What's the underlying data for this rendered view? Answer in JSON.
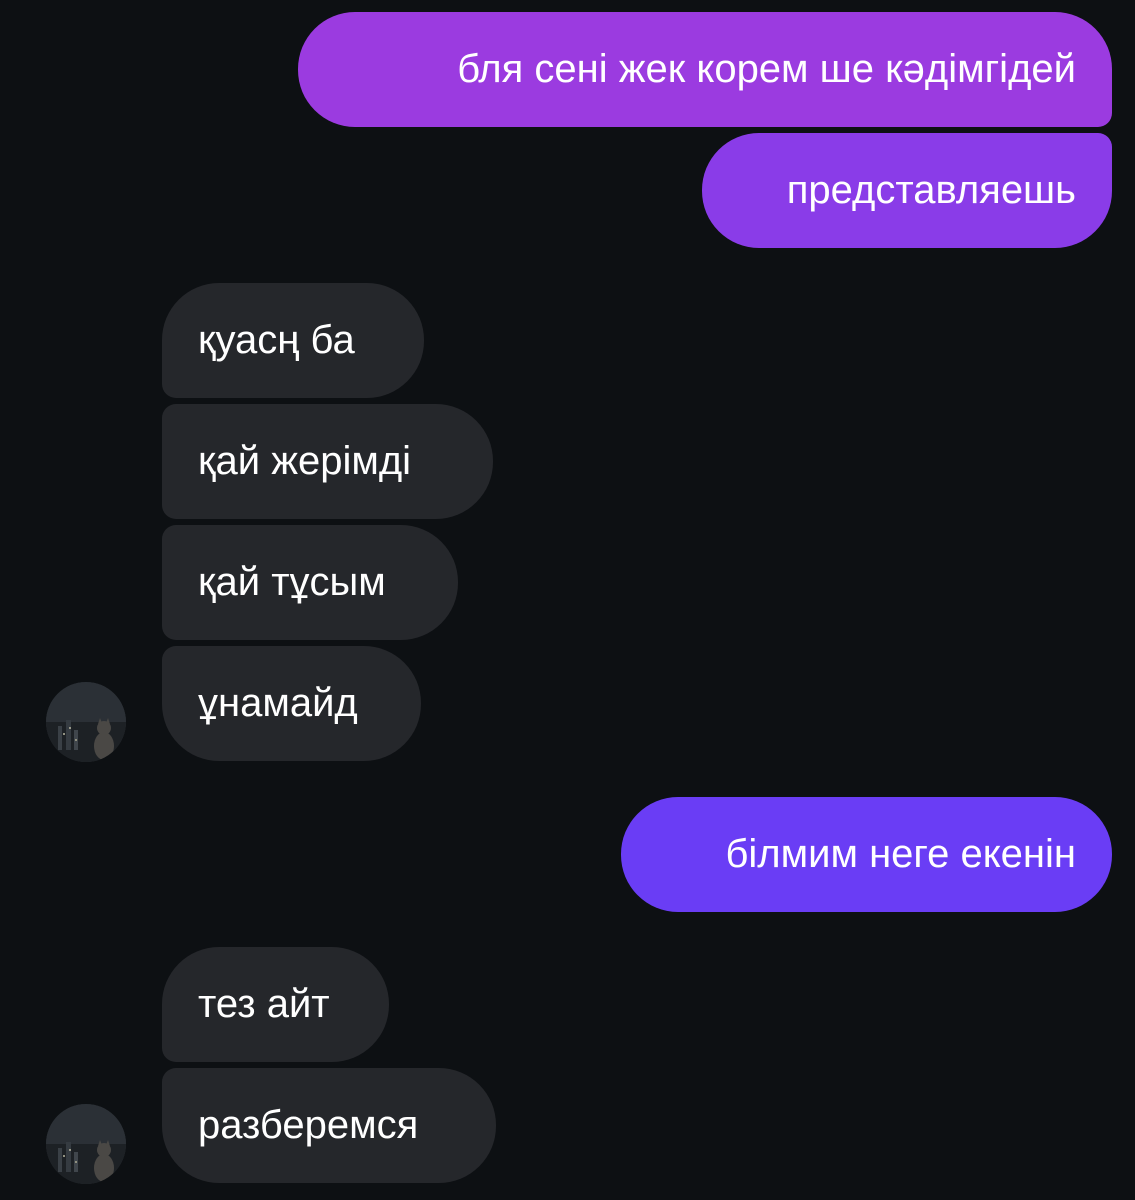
{
  "messages": [
    {
      "sender": "me",
      "text": "бля сені жек корем ше кәдімгідей"
    },
    {
      "sender": "me",
      "text": "представляешь"
    },
    {
      "sender": "them",
      "text": "қуасң ба"
    },
    {
      "sender": "them",
      "text": "қай жерімді"
    },
    {
      "sender": "them",
      "text": "қай тұсым"
    },
    {
      "sender": "them",
      "text": "ұнамайд"
    },
    {
      "sender": "me",
      "text": "білмим неге екенін"
    },
    {
      "sender": "them",
      "text": "тез айт"
    },
    {
      "sender": "them",
      "text": "разберемся"
    }
  ],
  "colors": {
    "background": "#0d1013",
    "outgoing_purple": "#9b3be0",
    "outgoing_violet": "#7a3cf2",
    "outgoing_indigo": "#6a3df5",
    "incoming": "#25272b",
    "text": "#ffffff"
  },
  "avatar": {
    "icon": "contact-avatar-photo"
  }
}
